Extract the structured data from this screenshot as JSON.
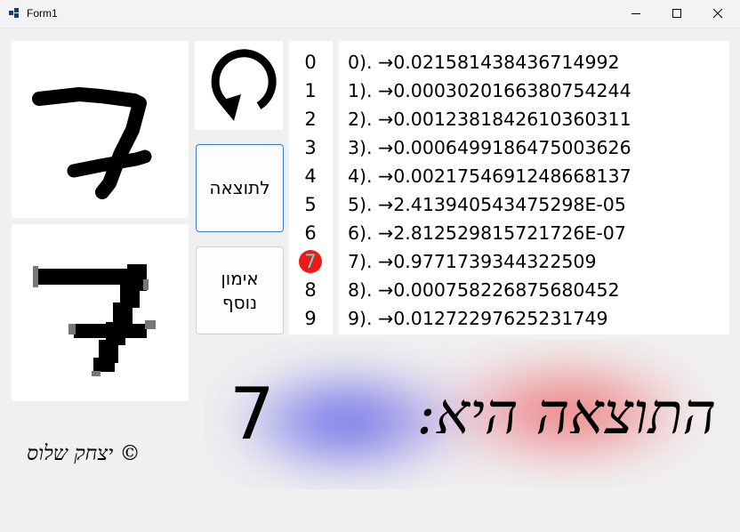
{
  "window": {
    "title": "Form1"
  },
  "buttons": {
    "result_label": "לתוצאה",
    "train_label_line1": "אימון",
    "train_label_line2": "נוסף"
  },
  "digits": [
    "0",
    "1",
    "2",
    "3",
    "4",
    "5",
    "6",
    "7",
    "8",
    "9"
  ],
  "highlighted_digit": "7",
  "probabilities": [
    "0). →0.021581438436714992",
    "1). →0.0003020166380754244",
    "2). →0.001238184261036031​1",
    "3). →0.0006499186475003626",
    "4). →0.002175469124866813​7",
    "5). →2.413940543475298E-05",
    "6). →2.81252981572172​6E-07",
    "7). →0.9771739344322509",
    "8). →0.000758226875680452",
    "9). →0.01272297625231749"
  ],
  "result": {
    "label": "התוצאה היא:",
    "digit": "7"
  },
  "copyright": "© יצחק שלוס",
  "colors": {
    "highlight_bg": "#ee1a1a",
    "highlight_fg": "#5ce0d4",
    "accent": "#3a7bd5"
  }
}
